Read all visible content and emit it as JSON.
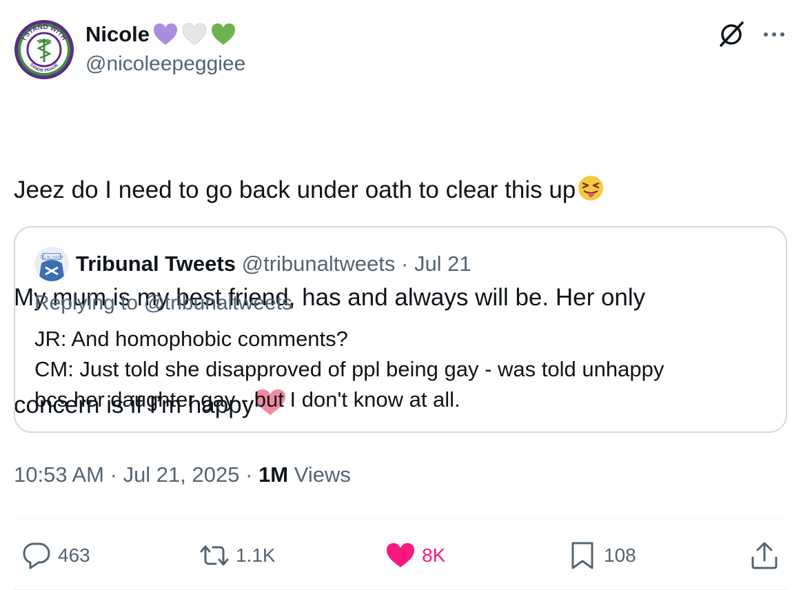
{
  "author": {
    "name": "Nicole",
    "handle": "@nicoleepeggiee",
    "name_emojis": [
      "purple-heart",
      "white-heart",
      "green-heart"
    ],
    "avatar_text_top": "I STAND WITH",
    "avatar_text_bottom": "SANDIE PEGGIE"
  },
  "tweet": {
    "lines": [
      "Jeez do I need to go back under oath to clear this up",
      "My mum is my best friend, has and always will be. Her only",
      "concern is if I’m happy"
    ],
    "emojis": [
      "squinting-face-with-tongue",
      "pink-heart"
    ]
  },
  "quote": {
    "name": "Tribunal Tweets",
    "handle": "@tribunaltweets",
    "separator": "·",
    "date": "Jul 21",
    "replying_prefix": "Replying to",
    "replying_to": "@tribunaltweets",
    "lines": [
      "JR: And homophobic comments?",
      "CM: Just told she disapproved of ppl being gay - was told unhappy",
      "bcs her daughter gay - but I don't know at all."
    ],
    "avatar_text": "DO NO HARM"
  },
  "meta": {
    "time": "10:53 AM",
    "separator": "·",
    "date": "Jul 21, 2025",
    "views": "1M",
    "views_label": "Views"
  },
  "actions": {
    "replies": "463",
    "reposts": "1.1K",
    "likes": "8K",
    "bookmarks": "108"
  },
  "colors": {
    "text_primary": "#0f1419",
    "text_secondary": "#536471",
    "border": "#cfd9de",
    "like_active": "#f91880",
    "purple_heart": "#a98ee0",
    "white_heart": "#e8e8e8",
    "green_heart": "#6fb24f",
    "pink_heart": "#f08aa0"
  },
  "icons": {
    "grok": "grok-icon",
    "more": "more-icon",
    "reply": "reply-icon",
    "repost": "repost-icon",
    "like": "heart-filled-icon",
    "bookmark": "bookmark-icon",
    "share": "share-icon"
  }
}
